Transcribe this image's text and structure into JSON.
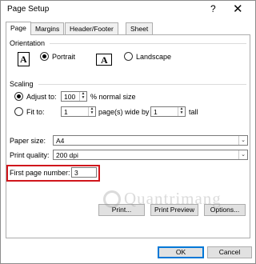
{
  "window": {
    "title": "Page Setup",
    "help_glyph": "?",
    "close_glyph": "✕"
  },
  "tabs": [
    {
      "label": "Page",
      "active": true
    },
    {
      "label": "Margins",
      "active": false
    },
    {
      "label": "Header/Footer",
      "active": false
    },
    {
      "label": "Sheet",
      "active": false
    }
  ],
  "orientation": {
    "group_label": "Orientation",
    "portrait_label": "Portrait",
    "landscape_label": "Landscape",
    "icon_letter": "A",
    "selected": "Portrait"
  },
  "scaling": {
    "group_label": "Scaling",
    "adjust_label": "Adjust to:",
    "adjust_value": "100",
    "adjust_suffix": "% normal size",
    "fit_label": "Fit to:",
    "fit_wide_value": "1",
    "fit_wide_suffix": "page(s) wide by",
    "fit_tall_value": "1",
    "fit_tall_suffix": "tall",
    "selected": "Adjust to"
  },
  "paper_size": {
    "label": "Paper size:",
    "value": "A4"
  },
  "print_quality": {
    "label": "Print quality:",
    "value": "200 dpi"
  },
  "first_page": {
    "label": "First page number:",
    "value": "3"
  },
  "buttons": {
    "print": "Print...",
    "print_preview": "Print Preview",
    "options": "Options...",
    "ok": "OK",
    "cancel": "Cancel"
  },
  "watermark": {
    "text": "Quantrimang"
  },
  "colors": {
    "highlight": "#d0161c",
    "default_button_border": "#0078d7"
  }
}
